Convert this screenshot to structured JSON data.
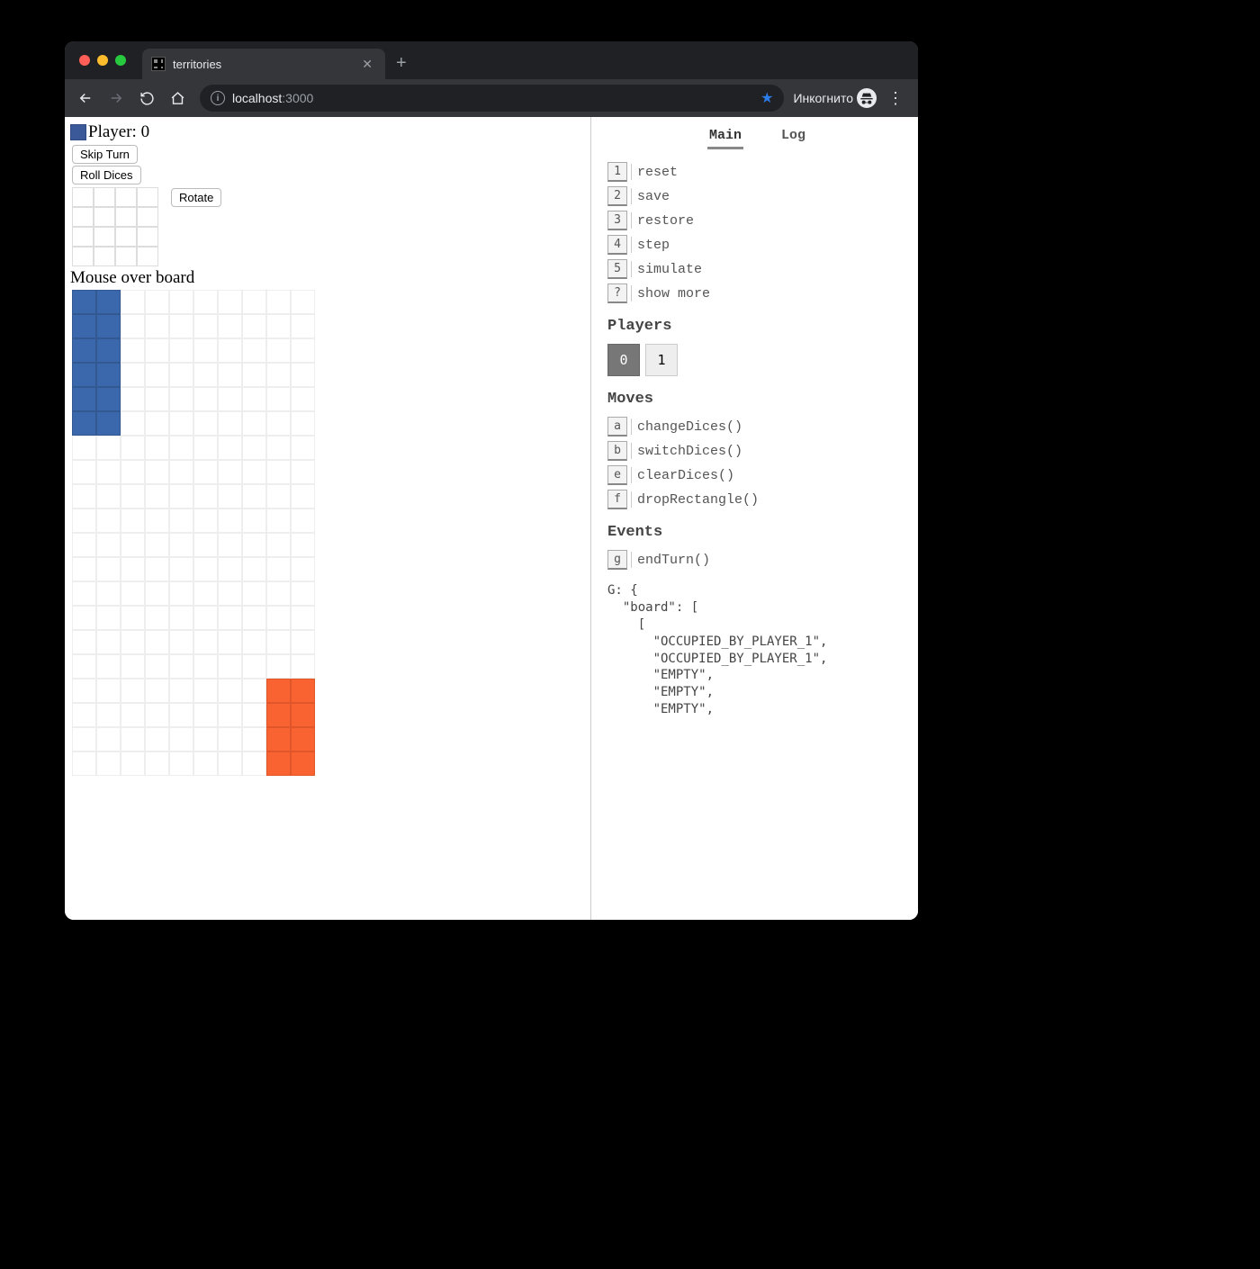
{
  "browser": {
    "tab_title": "territories",
    "url_host": "localhost",
    "url_port": ":3000",
    "incognito_label": "Инкогнито"
  },
  "game": {
    "player_prefix": "Player: ",
    "player_number": "0",
    "skip_turn": "Skip Turn",
    "roll_dices": "Roll Dices",
    "rotate": "Rotate",
    "mouse_hint": "Mouse over board",
    "colors": {
      "p1": "#3b68ad",
      "p2": "#f96332"
    },
    "board_cols": 10,
    "board_rows": 20,
    "p1_cells": [
      [
        0,
        0
      ],
      [
        0,
        1
      ],
      [
        1,
        0
      ],
      [
        1,
        1
      ],
      [
        2,
        0
      ],
      [
        2,
        1
      ],
      [
        3,
        0
      ],
      [
        3,
        1
      ],
      [
        4,
        0
      ],
      [
        4,
        1
      ],
      [
        5,
        0
      ],
      [
        5,
        1
      ]
    ],
    "p2_cells": [
      [
        16,
        8
      ],
      [
        16,
        9
      ],
      [
        17,
        8
      ],
      [
        17,
        9
      ],
      [
        18,
        8
      ],
      [
        18,
        9
      ],
      [
        19,
        8
      ],
      [
        19,
        9
      ]
    ]
  },
  "debug": {
    "tabs": {
      "main": "Main",
      "log": "Log"
    },
    "commands": [
      {
        "key": "1",
        "label": "reset"
      },
      {
        "key": "2",
        "label": "save"
      },
      {
        "key": "3",
        "label": "restore"
      },
      {
        "key": "4",
        "label": "step"
      },
      {
        "key": "5",
        "label": "simulate"
      },
      {
        "key": "?",
        "label": "show more"
      }
    ],
    "players_header": "Players",
    "players": [
      "0",
      "1"
    ],
    "active_player": "0",
    "moves_header": "Moves",
    "moves": [
      {
        "key": "a",
        "label": "changeDices()"
      },
      {
        "key": "b",
        "label": "switchDices()"
      },
      {
        "key": "e",
        "label": "clearDices()"
      },
      {
        "key": "f",
        "label": "dropRectangle()"
      }
    ],
    "events_header": "Events",
    "events": [
      {
        "key": "g",
        "label": "endTurn()"
      }
    ],
    "state_dump": "G: {\n  \"board\": [\n    [\n      \"OCCUPIED_BY_PLAYER_1\",\n      \"OCCUPIED_BY_PLAYER_1\",\n      \"EMPTY\",\n      \"EMPTY\",\n      \"EMPTY\","
  }
}
